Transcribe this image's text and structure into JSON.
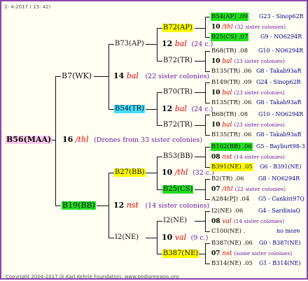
{
  "header": {
    "date": "2-  4-2017 ( 15: 42)"
  },
  "footer": {
    "copyright": "Copyright 2004-2017 @ Karl Kehrle Foundation.   www.pedigreeapis.org"
  },
  "subject": {
    "id": "B56(MAA)",
    "gen_num": "16",
    "gen_mark": "/thl",
    "note": "(Drones from 33 sister colonies)"
  },
  "gen1": {
    "top": {
      "id": "B7(WK)",
      "num": "14",
      "mark": "bal",
      "note": "(22 sister colonies)"
    },
    "bottom": {
      "id": "B19(BB)",
      "num": "12",
      "mark": "nst",
      "note": "(14 sister colonies)"
    }
  },
  "gen2": [
    {
      "id": "B73(AP)",
      "num": "12",
      "mark": "bal",
      "note": "(24 c.)"
    },
    {
      "id": "B54(TR)",
      "num": "12",
      "mark": "bal",
      "note": "(24 c.)"
    },
    {
      "id": "B27(BB)",
      "num": "10",
      "mark": "/thl",
      "note": "(32 c.)"
    },
    {
      "id": "I2(NE)",
      "num": "10",
      "mark": "val",
      "note": "(9 c.)"
    }
  ],
  "gen3": [
    {
      "id": "B72(AP)"
    },
    {
      "id": "B72(TR)"
    },
    {
      "id": "B70(TR)"
    },
    {
      "id": "B72(TR)"
    },
    {
      "id": "B53(BB)"
    },
    {
      "id": "B25(CS)"
    },
    {
      "id": "I2(NE)"
    },
    {
      "id": "B387(NE)"
    }
  ],
  "gen4": [
    {
      "queen": "B54(AP) .09",
      "queen_code": "G23 - Sinop62R",
      "num": "10",
      "mark": "/thl",
      "note": "(32 sister colonies)",
      "drone": "B25(CS) .07",
      "drone_code": "G9 - NO6294R"
    },
    {
      "queen": "B68(TR) .08",
      "queen_code": "G10 - NO6294R",
      "num": "10",
      "mark": "bal",
      "note": "(23 sister colonies)",
      "drone": "B135(TR) .06",
      "drone_code": "G8 - Takab93aR"
    },
    {
      "queen": "B149(TR) .09",
      "queen_code": "G24 - Sinop62R",
      "num": "10",
      "mark": "bal",
      "note": "(23 sister colonies)",
      "drone": "B135(TR) .06",
      "drone_code": "G8 - Takab93aR"
    },
    {
      "queen": "B68(TR) .08",
      "queen_code": "G10 - NO6294R",
      "num": "10",
      "mark": "bal",
      "note": "(23 sister colonies)",
      "drone": "B135(TR) .06",
      "drone_code": "G8 - Takab93aR"
    },
    {
      "queen": "B102(BB) .06",
      "queen_code": "G5 - Bayburt98-3",
      "num": "08",
      "mark": "nst",
      "note": "(14 sister colonies)",
      "drone": "B391(NE) .05",
      "drone_code": "G6 - B391(NE)"
    },
    {
      "queen": "B2(TR) .06",
      "queen_code": "G8 - NO6294R",
      "num": "07",
      "mark": "/thl",
      "note": "(22 sister colonies)",
      "drone": "A284(PJ) .04",
      "drone_code": "G5 - Cankiri97Q"
    },
    {
      "queen": "I2(NE) .06",
      "queen_code": "G4 - SardiniaQ",
      "num": "08",
      "mark": "val",
      "note": "(14 sister colonies)",
      "drone": "C100(NE) .",
      "drone_code": "no more"
    },
    {
      "queen": "B387(NE) .06",
      "queen_code": "G0 - B387(NE)",
      "num": "07",
      "mark": "nst",
      "note": "(some sister colonies)",
      "drone": "B314(NE) .05",
      "drone_code": "G1 - B314(NE)"
    }
  ],
  "colors": {
    "frame": "#8e44ad",
    "yellow": "#ffff00",
    "green": "#22dd22",
    "cyan": "#44ddff",
    "pink": "#ffccee",
    "mark_red": "#e00000",
    "code_blue": "#00008b"
  }
}
